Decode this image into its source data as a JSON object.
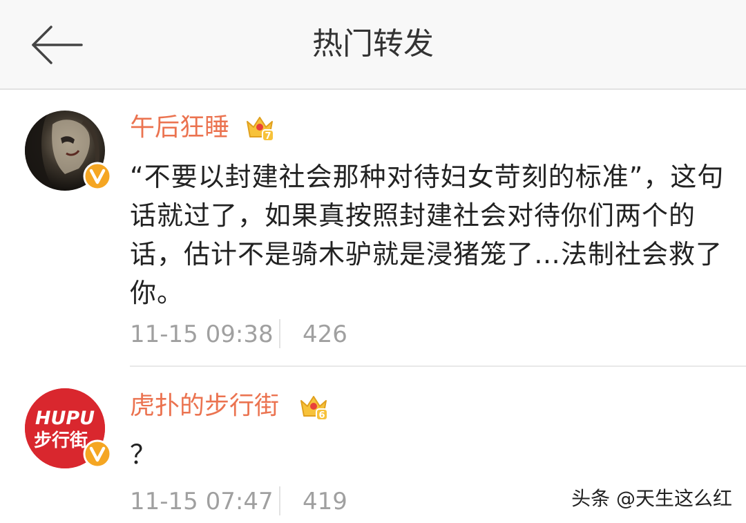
{
  "header": {
    "title": "热门转发"
  },
  "posts": [
    {
      "username": "午后狂睡",
      "vip_level": "7",
      "content": "“不要以封建社会那种对待妇女苛刻的标准”，这句话就过了，如果真按照封建社会对待你们两个的话，估计不是骑木驴就是浸猪笼了…法制社会救了你。",
      "time": "11-15 09:38",
      "count": "426"
    },
    {
      "username": "虎扑的步行街",
      "avatar_text_top": "HUPU",
      "avatar_text_bottom": "步行街",
      "vip_level": "6",
      "content": "？",
      "time": "11-15 07:47",
      "count": "419"
    }
  ],
  "watermark": "头条 @天生这么红",
  "colors": {
    "username": "#eb7350",
    "meta": "#a0a0a0",
    "verified": "#f5a623",
    "hupu_red": "#d9272e",
    "crown_gold": "#f7c23a"
  }
}
